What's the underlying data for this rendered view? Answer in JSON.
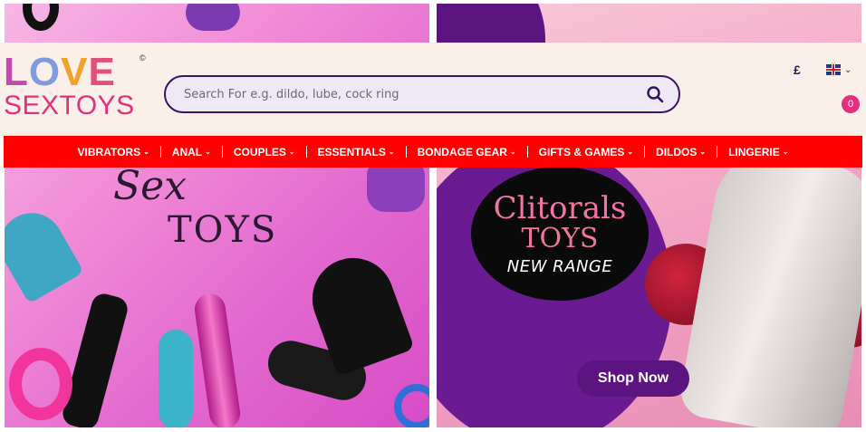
{
  "logo": {
    "love_letters": [
      "L",
      "O",
      "V",
      "E"
    ],
    "love_colors": [
      "#c34ab1",
      "#7f9cde",
      "#f2a12b",
      "#e14f7d"
    ],
    "line2": "SEXTOYS",
    "copyright": "©"
  },
  "search": {
    "placeholder": "Search For e.g. dildo, lube, cock ring"
  },
  "header": {
    "currency": "£",
    "language_chevron": "⌄",
    "cart_count": "0"
  },
  "nav": {
    "items": [
      {
        "label": "VIBRATORS"
      },
      {
        "label": "ANAL"
      },
      {
        "label": "COUPLES"
      },
      {
        "label": "ESSENTIALS"
      },
      {
        "label": "BONDAGE GEAR"
      },
      {
        "label": "GIFTS & GAMES"
      },
      {
        "label": "DILDOS"
      },
      {
        "label": "LINGERIE"
      }
    ]
  },
  "banner_left": {
    "title_line1": "Sex",
    "title_line2": "TOYS"
  },
  "banner_right": {
    "badge_line1": "Clitorals",
    "badge_line2": "TOYS",
    "badge_line3": "NEW RANGE",
    "cta_label": "Shop Now"
  },
  "colors": {
    "nav_bg": "#ff0000",
    "header_bg": "#fbefe9",
    "search_border": "#3a1566",
    "cta_bg": "#5b1480",
    "cart_badge": "#e2307d"
  }
}
